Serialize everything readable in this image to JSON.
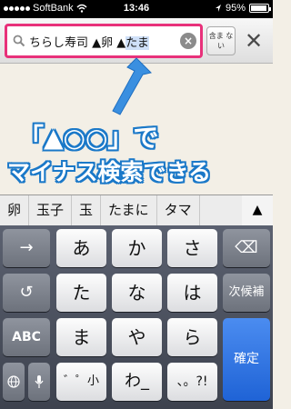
{
  "status_bar": {
    "carrier": "SoftBank",
    "time": "13:46",
    "battery_percent": "95%",
    "battery_level": 0.95
  },
  "search": {
    "query_prefix": "ちらし寿司 ▲卵 ▲",
    "query_composing": "たま",
    "clear_icon": "clear-x-icon",
    "or_label_1": "含ま",
    "or_label_2": "ない",
    "close_label": "✕"
  },
  "annotation": {
    "line1": "「▲○○」で",
    "line2": "マイナス検索できる",
    "text_color": "#ffffff",
    "outline_color": "#1a78c8",
    "arrow_color": "#3a8fe0",
    "highlight_border": "#e8317a"
  },
  "candidates": [
    "卵",
    "玉子",
    "玉",
    "たまに",
    "タマ"
  ],
  "candidate_expand": "▲",
  "keyboard": {
    "row1": {
      "left": "→",
      "keys": [
        "あ",
        "か",
        "さ"
      ],
      "right": "⌫"
    },
    "row2": {
      "left": "↺",
      "keys": [
        "た",
        "な",
        "は"
      ],
      "right": "次候補"
    },
    "row3": {
      "left": "ABC",
      "keys": [
        "ま",
        "や",
        "ら"
      ]
    },
    "row4": {
      "globe": "🌐",
      "mic": "mic-icon",
      "keys": [
        "゛゜小",
        "わ_",
        "、。?!"
      ]
    },
    "confirm": "確定"
  }
}
